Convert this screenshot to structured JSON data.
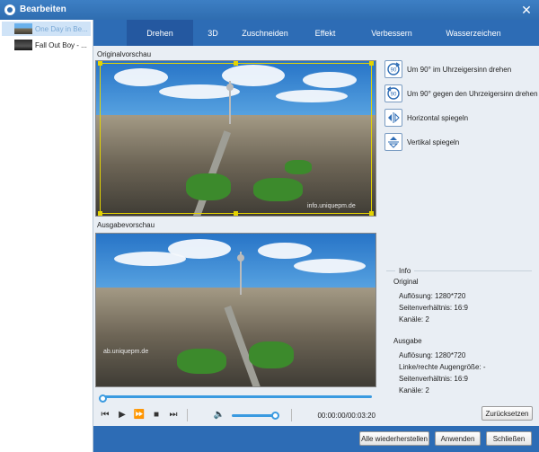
{
  "window": {
    "title": "Bearbeiten"
  },
  "files": [
    {
      "name": "One Day in Be...",
      "selected": true
    },
    {
      "name": "Fall Out Boy - ...",
      "selected": false
    }
  ],
  "tabs": [
    {
      "label": "Drehen",
      "active": true
    },
    {
      "label": "3D",
      "active": false
    },
    {
      "label": "Zuschneiden",
      "active": false
    },
    {
      "label": "Effekt",
      "active": false
    },
    {
      "label": "Verbessern",
      "active": false
    },
    {
      "label": "Wasserzeichen",
      "active": false
    }
  ],
  "previews": {
    "original_label": "Originalvorschau",
    "output_label": "Ausgabevorschau",
    "watermark_original": "info.uniquepm.de",
    "watermark_output": "ab.uniquepm.de"
  },
  "rotate": {
    "cw_label": "Um 90° im Uhrzeigersinn drehen",
    "ccw_label": "Um 90° gegen den Uhrzeigersinn drehen",
    "flip_h_label": "Horizontal spiegeln",
    "flip_v_label": "Vertikal spiegeln",
    "icon_text": "90"
  },
  "info": {
    "legend": "Info",
    "original_heading": "Original",
    "original_resolution": "Auflösung: 1280*720",
    "original_aspect": "Seitenverhältnis: 16:9",
    "original_channels": "Kanäle: 2",
    "output_heading": "Ausgabe",
    "output_resolution": "Auflösung: 1280*720",
    "output_eye": "Linke/rechte Augengröße: -",
    "output_aspect": "Seitenverhältnis: 16:9",
    "output_channels": "Kanäle: 2"
  },
  "player": {
    "time": "00:00:00/00:03:20",
    "progress": 0.0,
    "volume": 0.95
  },
  "buttons": {
    "reset": "Zurücksetzen",
    "restore_all": "Alle wiederherstellen",
    "apply": "Anwenden",
    "close": "Schließen"
  },
  "icons": {
    "app": "app-logo-icon",
    "close": "close-icon",
    "skip_start": "skip-start-icon",
    "play": "play-icon",
    "fast_forward": "fast-forward-icon",
    "stop": "stop-icon",
    "skip_end": "skip-end-icon",
    "volume": "volume-icon"
  },
  "colors": {
    "accent": "#2d6cb5",
    "progress": "#3a9ae0",
    "crop": "#e5d400"
  }
}
